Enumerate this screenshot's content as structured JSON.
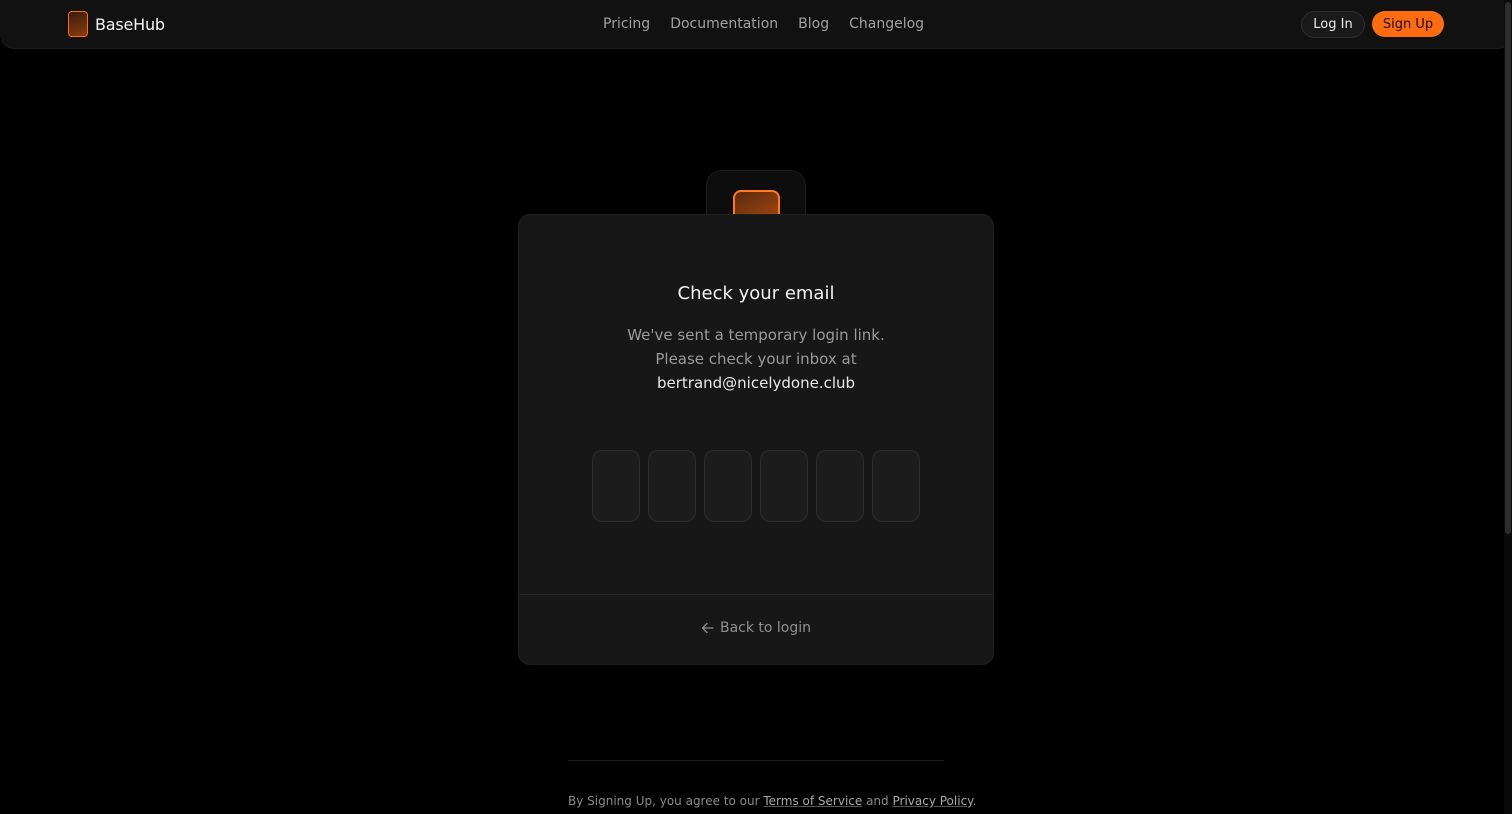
{
  "nav": {
    "brand": "BaseHub",
    "links": [
      "Pricing",
      "Documentation",
      "Blog",
      "Changelog"
    ],
    "login_label": "Log In",
    "signup_label": "Sign Up"
  },
  "card": {
    "title": "Check your email",
    "desc_line1": "We've sent a temporary login link.",
    "desc_line2": "Please check your inbox at",
    "email": "bertrand@nicelydone.club",
    "code_digits": [
      "",
      "",
      "",
      "",
      "",
      ""
    ],
    "back_label": "Back to login"
  },
  "footer": {
    "prefix": "By Signing Up, you agree to our ",
    "terms_label": "Terms of Service",
    "and": " and ",
    "privacy_label": "Privacy Policy",
    "suffix": "."
  },
  "colors": {
    "accent": "#ff6c0f",
    "background": "#000000",
    "card": "#171717"
  },
  "icons": {
    "brand": "basehub-logo-icon",
    "back": "arrow-left-icon"
  }
}
